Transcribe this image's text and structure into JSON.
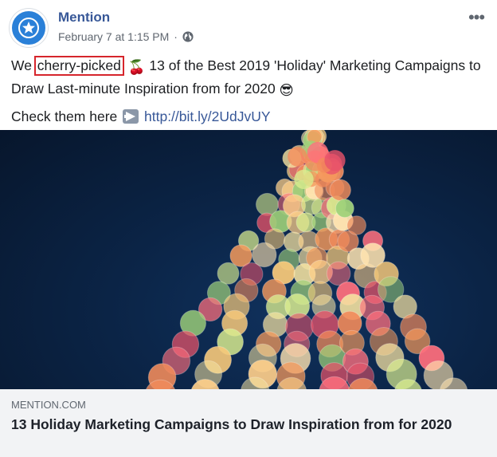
{
  "header": {
    "page_name": "Mention",
    "timestamp": "February 7 at 1:15 PM",
    "separator": "·",
    "more_icon": "more-horizontal-icon",
    "globe_icon": "globe-icon",
    "avatar_icon": "star-icon"
  },
  "post": {
    "text_before": "We ",
    "highlighted": "cherry-picked",
    "emoji_cherry": "🍒",
    "text_after": " 13 of the Best 2019 'Holiday' Marketing Campaigns to Draw Last-minute Inspiration from for 2020 ",
    "emoji_sunglasses": "😎",
    "check_text": "Check them here ",
    "arrow_icon": "right-arrow-icon",
    "link": "http://bit.ly/2UdJvUY"
  },
  "preview": {
    "domain": "MENTION.COM",
    "headline": "13 Holiday Marketing Campaigns to Draw Inspiration from for 2020"
  },
  "colors": {
    "brand": "#385898",
    "highlight_border": "#d6252c",
    "avatar": "#2a80d8",
    "hero_bg": "#0b2446"
  }
}
